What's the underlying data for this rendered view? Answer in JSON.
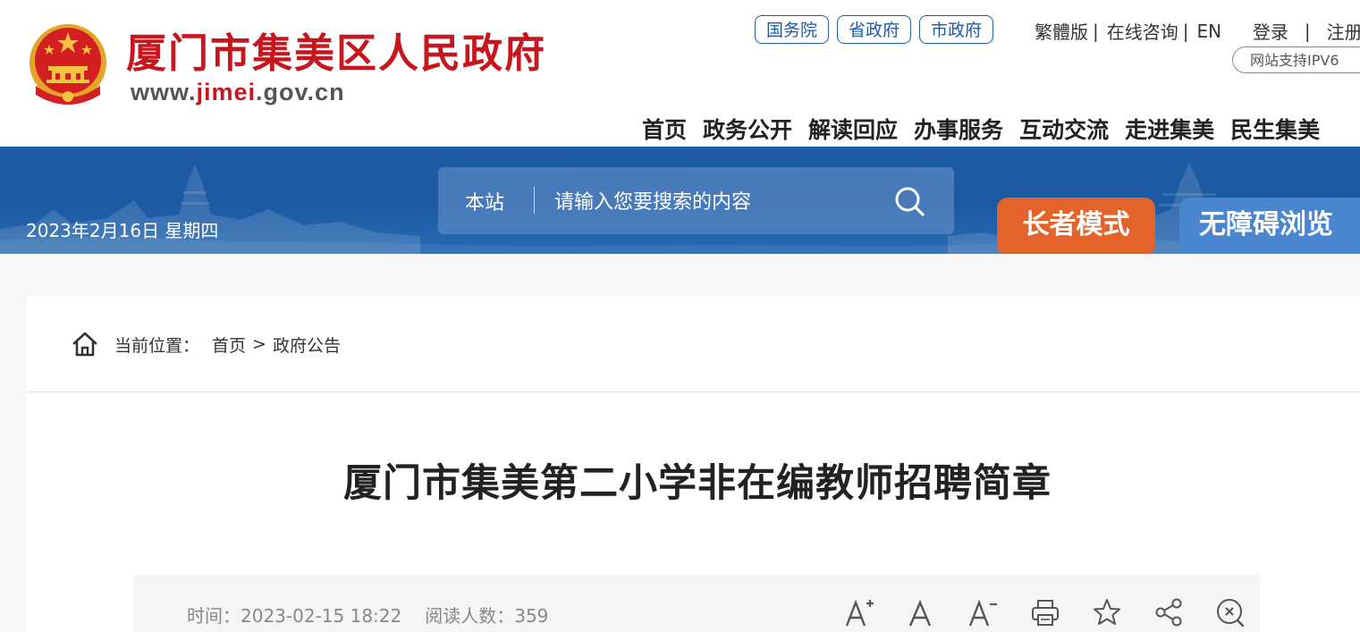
{
  "header": {
    "site_title": "厦门市集美区人民政府",
    "domain_prefix": "www.",
    "domain_highlight": "jimei",
    "domain_suffix": ".gov.cn",
    "gov_links": [
      "国务院",
      "省政府",
      "市政府"
    ],
    "top_links": [
      "繁體版",
      "在线咨询",
      "EN",
      "登录",
      "注册"
    ],
    "ipv6_badge": "网站支持IPV6",
    "main_nav": [
      "首页",
      "政务公开",
      "解读回应",
      "办事服务",
      "互动交流",
      "走进集美",
      "民生集美"
    ]
  },
  "banner": {
    "date": "2023年2月16日 星期四",
    "search_scope": "本站",
    "search_placeholder": "请输入您要搜索的内容",
    "elder_mode": "长者模式",
    "accessibility": "无障碍浏览"
  },
  "breadcrumb": {
    "label": "当前位置：",
    "items": [
      "首页",
      "政府公告"
    ],
    "separator": ">"
  },
  "article": {
    "title": "厦门市集美第二小学非在编教师招聘简章",
    "time_label": "时间：",
    "time_value": "2023-02-15 18:22",
    "views_label": "阅读人数：",
    "views_value": "359",
    "tools": [
      "font-larger-icon",
      "font-normal-icon",
      "font-smaller-icon",
      "print-icon",
      "favorite-star-icon",
      "share-icon",
      "close-zoom-icon"
    ]
  },
  "colors": {
    "brand_red": "#c8161e",
    "brand_blue": "#1e5aa8",
    "elder_orange": "#e4632b",
    "access_blue": "#4a86d0"
  }
}
